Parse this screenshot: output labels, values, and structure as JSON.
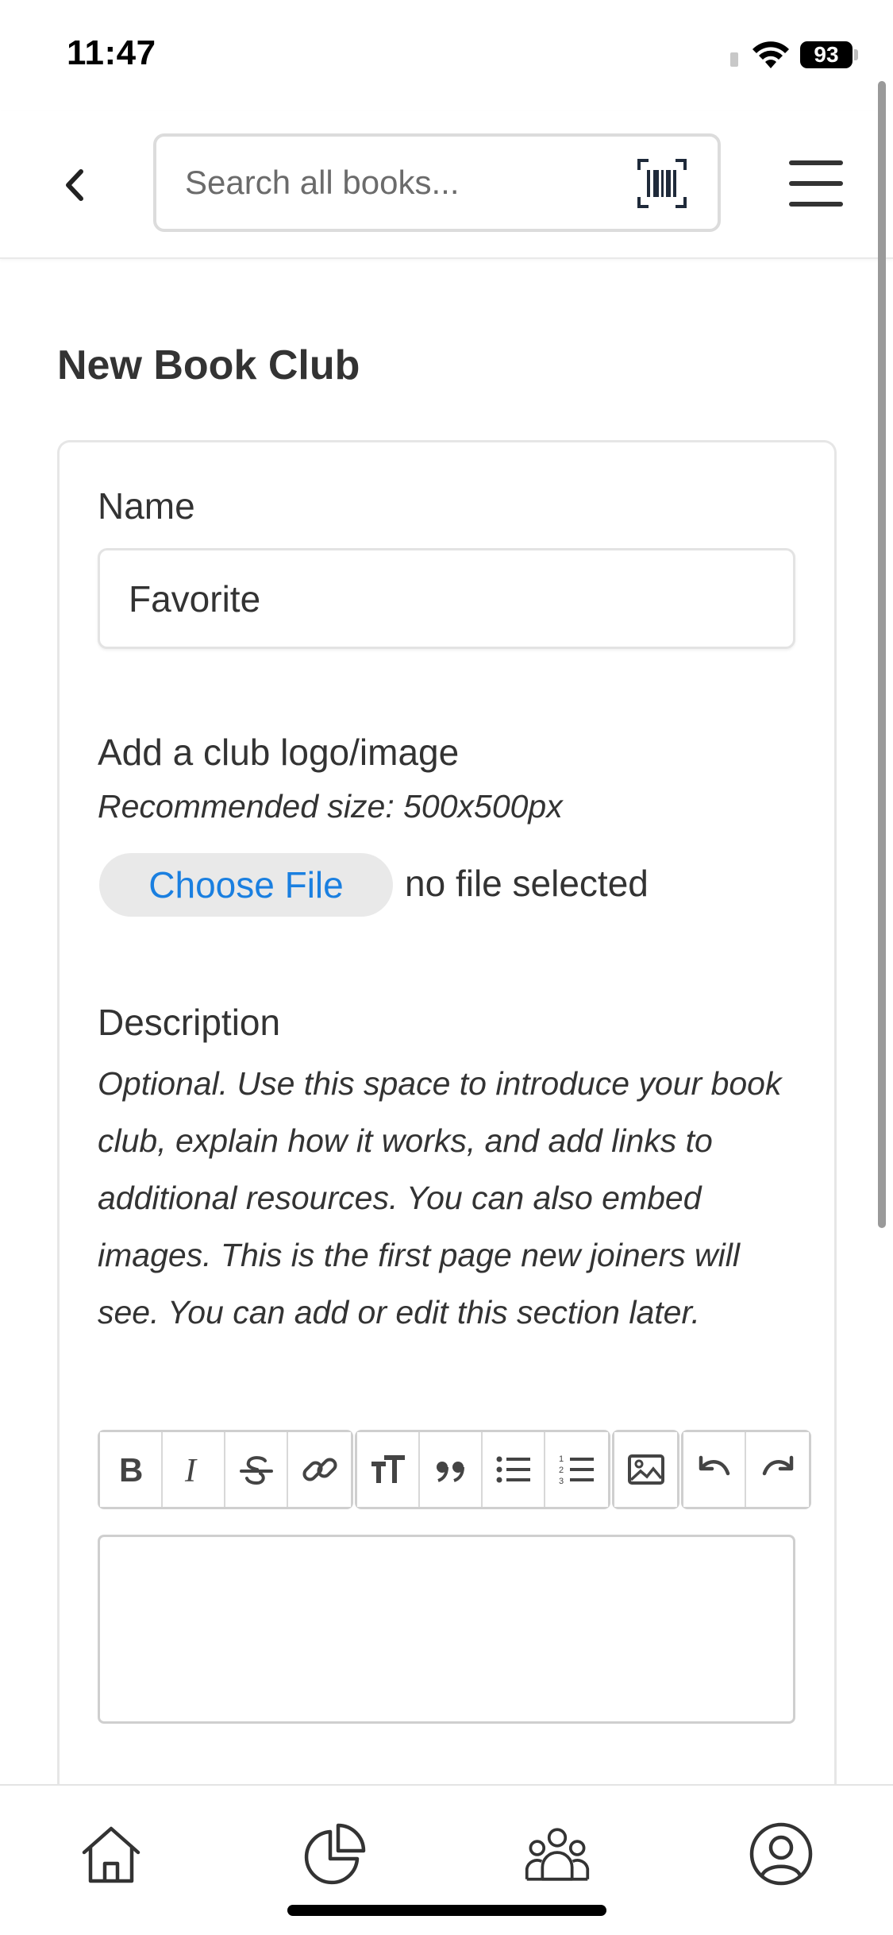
{
  "status_bar": {
    "time": "11:47",
    "battery": "93"
  },
  "header": {
    "search_placeholder": "Search all books...",
    "icons": [
      "chevron-left-icon",
      "barcode-icon",
      "hamburger-menu-icon"
    ]
  },
  "page": {
    "title": "New Book Club"
  },
  "form": {
    "name_label": "Name",
    "name_value": "Favorite",
    "logo_label": "Add a club logo/image",
    "logo_hint": "Recommended size: 500x500px",
    "choose_file_label": "Choose File",
    "file_status": "no file selected",
    "description_label": "Description",
    "description_hint": "Optional. Use this space to introduce your book club, explain how it works, and add links to additional resources. You can also embed images. This is the first page new joiners will see. You can add or edit this section later.",
    "description_value": ""
  },
  "editor_toolbar": {
    "groups": [
      [
        "bold-icon",
        "italic-icon",
        "strikethrough-icon",
        "link-icon"
      ],
      [
        "heading-icon",
        "quote-icon",
        "bullet-list-icon",
        "numbered-list-icon"
      ],
      [
        "image-icon"
      ],
      [
        "undo-icon",
        "redo-icon"
      ]
    ]
  },
  "bottom_nav": {
    "items": [
      "home-icon",
      "stats-pie-icon",
      "community-icon",
      "profile-icon"
    ]
  },
  "colors": {
    "accent": "#1a7fe0",
    "text": "#333333",
    "border": "#e3e3e3",
    "button_bg": "#e9e9e9"
  }
}
